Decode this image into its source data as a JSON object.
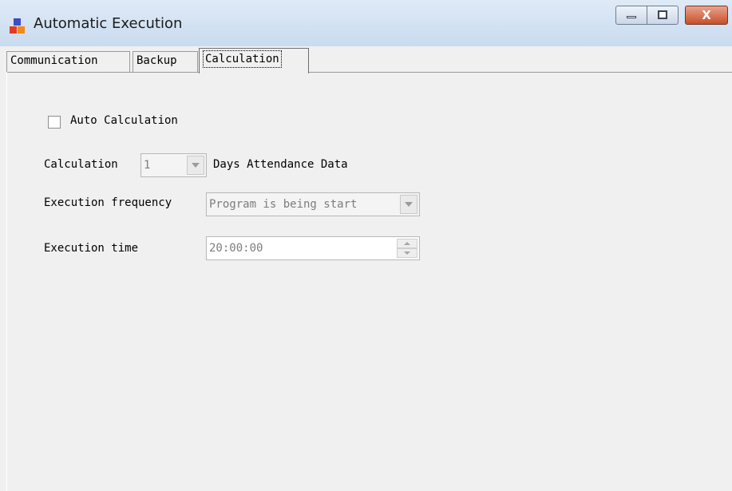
{
  "window": {
    "title": "Automatic Execution",
    "controls": {
      "minimize_icon": "minimize-icon",
      "maximize_icon": "maximize-icon",
      "close_symbol": "X"
    },
    "icon_colors": {
      "top": "#3a4ec5",
      "left": "#e23a22",
      "right": "#f08a1c"
    }
  },
  "tabs": [
    {
      "label": "Communication",
      "active": false
    },
    {
      "label": "Backup",
      "active": false
    },
    {
      "label": "Calculation",
      "active": true
    }
  ],
  "form": {
    "auto_calculation": {
      "label": "Auto Calculation",
      "checked": false
    },
    "calculation": {
      "prefix": "Calculation",
      "value": "1",
      "suffix": "Days Attendance Data"
    },
    "execution_frequency": {
      "label": "Execution frequency",
      "value": "Program is being start"
    },
    "execution_time": {
      "label": "Execution time",
      "value": "20:00:00"
    }
  }
}
